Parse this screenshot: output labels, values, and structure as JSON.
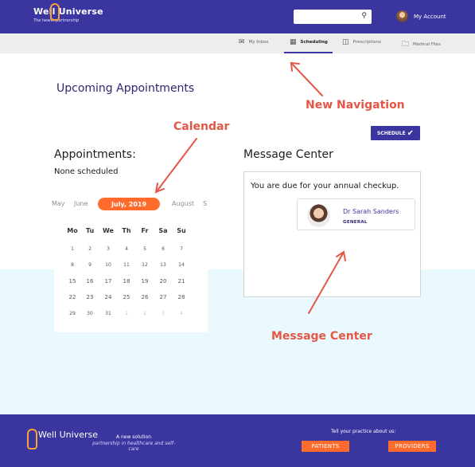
{
  "header": {
    "logo": {
      "name": "Well Universe",
      "tagline": "The health partnership"
    },
    "search": {
      "placeholder": ""
    },
    "account_label": "My Account"
  },
  "nav": [
    {
      "label": "My Inbox",
      "icon": "envelope-icon",
      "active": false
    },
    {
      "label": "Scheduling",
      "icon": "calendar-icon",
      "active": true
    },
    {
      "label": "Prescriptions",
      "icon": "document-icon",
      "active": false
    },
    {
      "label": "Medical Files",
      "icon": "folder-icon",
      "active": false
    }
  ],
  "page_title": "Upcoming Appointments",
  "schedule_button": {
    "label": "SCHEDULE",
    "icon": "checkmark-icon"
  },
  "appointments": {
    "title": "Appointments:",
    "status": "None scheduled"
  },
  "calendar": {
    "months": [
      "May",
      "June",
      "July, 2019",
      "August",
      "S"
    ],
    "active_month": "July, 2019",
    "weekdays": [
      "Mo",
      "Tu",
      "We",
      "Th",
      "Fr",
      "Sa",
      "Su"
    ],
    "weeks": [
      [
        "1",
        "2",
        "3",
        "4",
        "5",
        "6",
        "7"
      ],
      [
        "8",
        "9",
        "10",
        "11",
        "12",
        "13",
        "14"
      ],
      [
        "15",
        "16",
        "17",
        "18",
        "19",
        "20",
        "21"
      ],
      [
        "22",
        "23",
        "24",
        "25",
        "26",
        "27",
        "28"
      ],
      [
        "29",
        "30",
        "31",
        "1",
        "2",
        "3",
        "4"
      ]
    ]
  },
  "message_center": {
    "title": "Message Center",
    "message": "You are due for your annual checkup.",
    "doctor": {
      "name": "Dr Sarah Sanders",
      "role": "GENERAL"
    }
  },
  "annotations": {
    "new_navigation": "New Navigation",
    "calendar": "Calendar",
    "message_center": "Message Center"
  },
  "footer": {
    "logo": "Well Universe",
    "tagline_1": "A new solution",
    "tagline_2": "partnership in healthcare and self-care",
    "cta_label": "Tell your practice about us:",
    "patients_button": "PATIENTS",
    "providers_button": "PROVIDERS"
  },
  "colors": {
    "brand": "#3b35a0",
    "accent": "#ff6b2d",
    "annotation": "#e45746",
    "band": "#eaf9fd"
  }
}
